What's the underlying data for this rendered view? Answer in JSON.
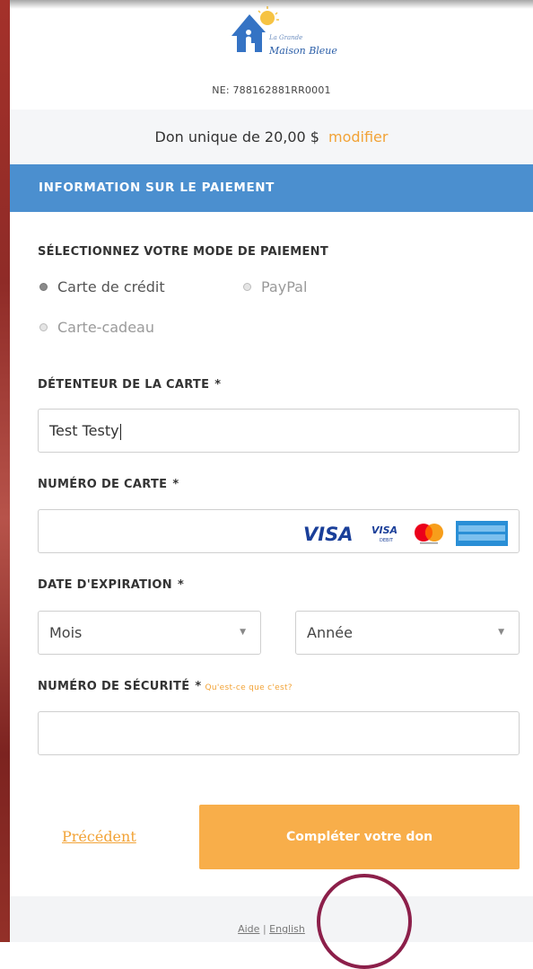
{
  "header": {
    "logo_name": "La Grande Maison Bleue",
    "logo_line1": "La Grande",
    "logo_line2": "Maison Bleue",
    "ne_number": "NE: 788162881RR0001"
  },
  "summary": {
    "text": "Don unique de 20,00 $",
    "modify_label": "modifier"
  },
  "section": {
    "title": "INFORMATION SUR LE PAIEMENT"
  },
  "payment_method": {
    "label": "SÉLECTIONNEZ VOTRE MODE DE PAIEMENT",
    "options": [
      {
        "label": "Carte de crédit",
        "checked": true
      },
      {
        "label": "PayPal",
        "checked": false
      },
      {
        "label": "Carte-cadeau",
        "checked": false
      }
    ]
  },
  "cardholder": {
    "label": "DÉTENTEUR DE LA CARTE",
    "required": "*",
    "value": "Test Testy"
  },
  "card_number": {
    "label": "NUMÉRO DE CARTE",
    "required": "*",
    "value": "",
    "logos": [
      "VISA",
      "VISA DEBIT",
      "Mastercard",
      "American Express"
    ],
    "visa_text": "VISA",
    "visa_small_text": "VISA",
    "visa_small_sub": "DEBIT"
  },
  "expiration": {
    "label": "DATE D'EXPIRATION",
    "required": "*",
    "month_value": "Mois",
    "year_value": "Année"
  },
  "security": {
    "label": "NUMÉRO DE SÉCURITÉ",
    "required": "*",
    "help_link": "Qu'est-ce que c'est?",
    "value": ""
  },
  "actions": {
    "back_label": "Précédent",
    "submit_label": "Compléter votre don"
  },
  "footer": {
    "help_label": "Aide",
    "separator": "|",
    "english_label": "English"
  },
  "colors": {
    "section_blue": "#4b8fcf",
    "accent_orange": "#f2a337",
    "button_orange": "#f8ae4a",
    "annotation_circle": "#8c1f4a"
  }
}
